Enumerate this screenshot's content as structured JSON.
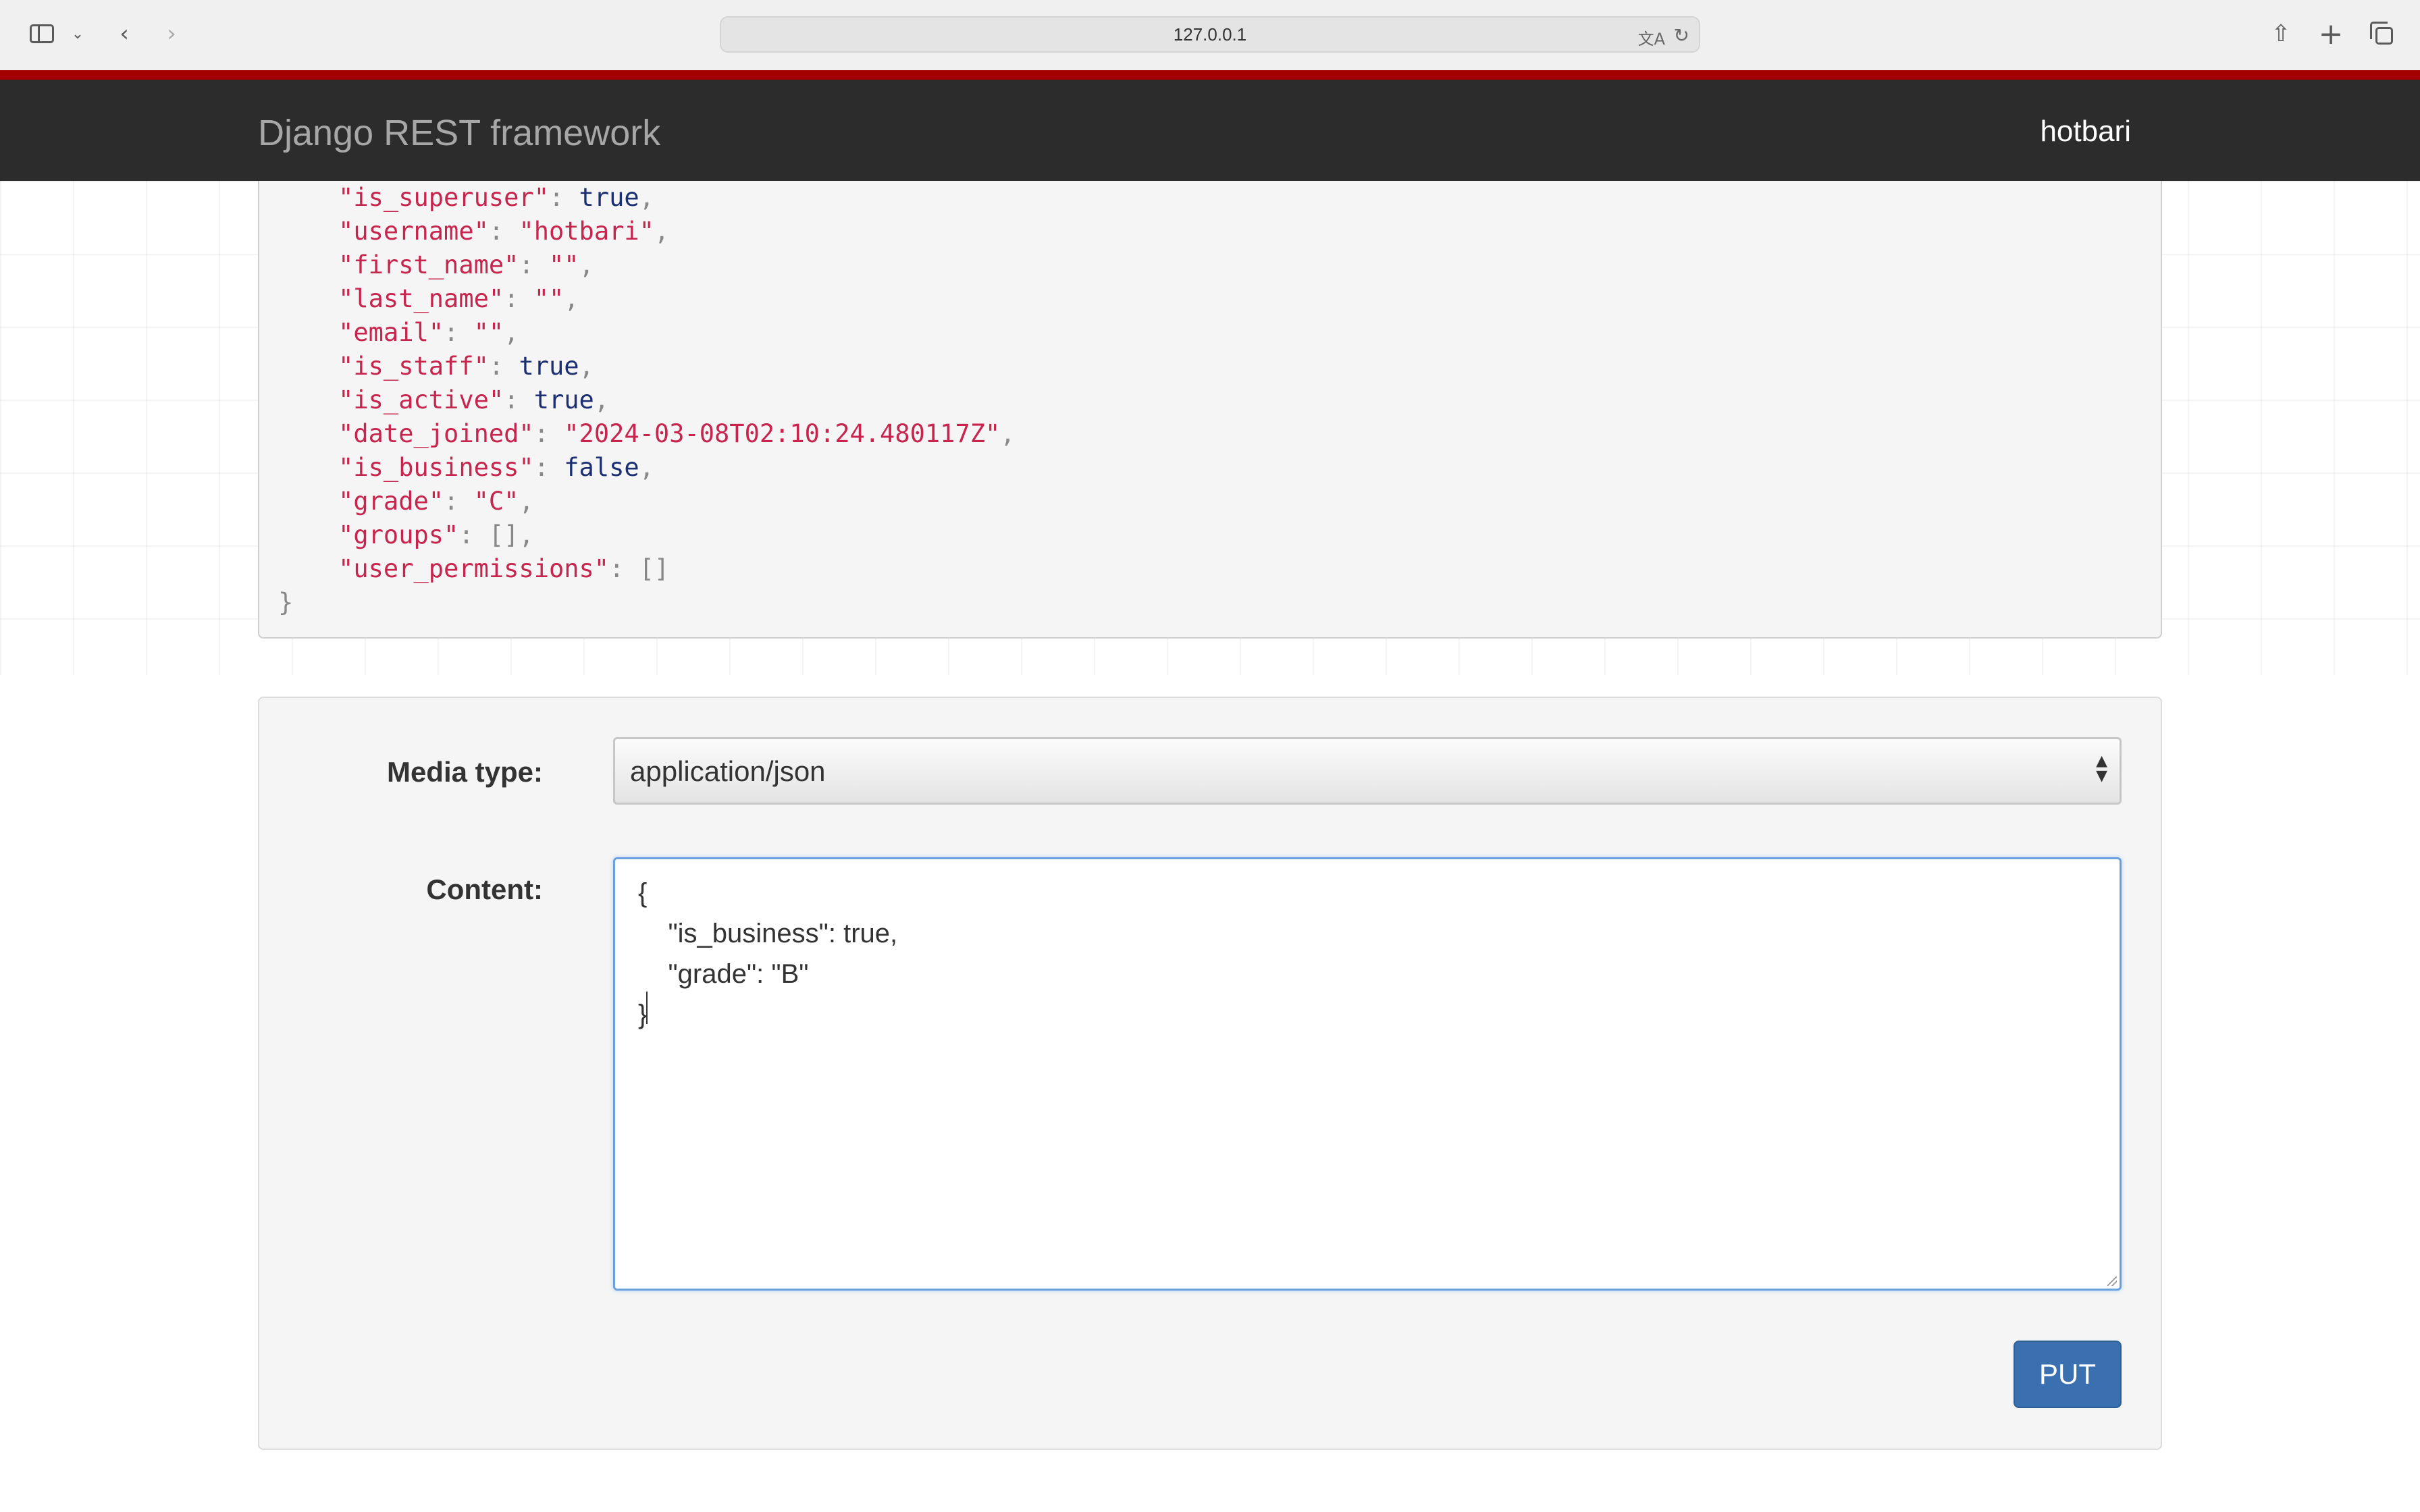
{
  "browser": {
    "url": "127.0.0.1",
    "icons": {
      "sidebar": "sidebar-icon",
      "chevron": "chevron-down-icon",
      "back": "back-arrow-icon",
      "forward": "forward-arrow-icon",
      "translate": "translate-icon",
      "reload": "reload-icon",
      "share": "share-icon",
      "new_tab": "plus-icon",
      "tab_overview": "tabs-icon"
    }
  },
  "navbar": {
    "brand": "Django REST framework",
    "user": "hotbari"
  },
  "response": {
    "lines": [
      {
        "key": "\"is_superuser\"",
        "value": "true",
        "kind": "literal",
        "comma": true
      },
      {
        "key": "\"username\"",
        "value": "\"hotbari\"",
        "kind": "string",
        "comma": true
      },
      {
        "key": "\"first_name\"",
        "value": "\"\"",
        "kind": "string",
        "comma": true
      },
      {
        "key": "\"last_name\"",
        "value": "\"\"",
        "kind": "string",
        "comma": true
      },
      {
        "key": "\"email\"",
        "value": "\"\"",
        "kind": "string",
        "comma": true
      },
      {
        "key": "\"is_staff\"",
        "value": "true",
        "kind": "literal",
        "comma": true
      },
      {
        "key": "\"is_active\"",
        "value": "true",
        "kind": "literal",
        "comma": true
      },
      {
        "key": "\"date_joined\"",
        "value": "\"2024-03-08T02:10:24.480117Z\"",
        "kind": "string",
        "comma": true
      },
      {
        "key": "\"is_business\"",
        "value": "false",
        "kind": "literal",
        "comma": true
      },
      {
        "key": "\"grade\"",
        "value": "\"C\"",
        "kind": "string",
        "comma": true
      },
      {
        "key": "\"groups\"",
        "value": "[]",
        "kind": "punct",
        "comma": true
      },
      {
        "key": "\"user_permissions\"",
        "value": "[]",
        "kind": "punct",
        "comma": false
      }
    ],
    "closing": "}"
  },
  "form": {
    "media_label": "Media type:",
    "media_value": "application/json",
    "content_label": "Content:",
    "content_value": "{\n    \"is_business\": true,\n    \"grade\": \"B\"\n}",
    "submit_label": "PUT"
  },
  "colors": {
    "accent_red": "#a30000",
    "navbar_bg": "#2c2c2c",
    "json_key": "#c7254e",
    "json_literal": "#1c2f73",
    "button_blue": "#3a6fb0"
  }
}
